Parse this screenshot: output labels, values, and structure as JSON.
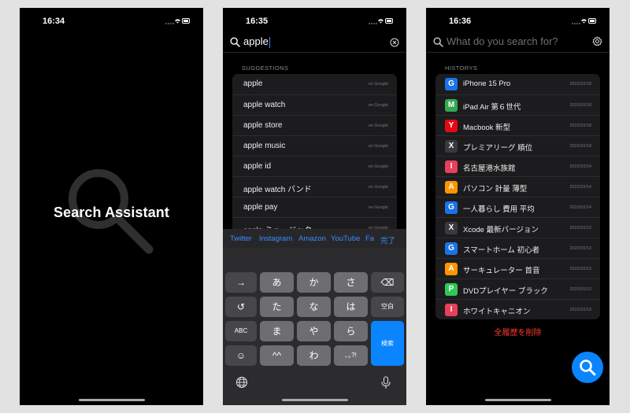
{
  "screen1": {
    "status": {
      "time": "16:34"
    },
    "title": "Search Assistant"
  },
  "screen2": {
    "status": {
      "time": "16:35"
    },
    "search_value": "apple",
    "section_label": "SUGGESTIONS",
    "suggestions": [
      {
        "label": "apple",
        "source": "on Google"
      },
      {
        "label": "apple watch",
        "source": "on Google"
      },
      {
        "label": "apple store",
        "source": "on Google"
      },
      {
        "label": "apple music",
        "source": "on Google"
      },
      {
        "label": "apple id",
        "source": "on Google"
      },
      {
        "label": "apple watch バンド",
        "source": "on Google"
      },
      {
        "label": "apple pay",
        "source": "on Google"
      },
      {
        "label": "apple ミュージック",
        "source": "on Google"
      }
    ],
    "keyboard_suggestions": [
      "Twitter",
      "Instagram",
      "Amazon",
      "YouTube",
      "Fa"
    ],
    "done_label": "完了",
    "keys": {
      "r1": [
        "→",
        "あ",
        "か",
        "さ",
        "⌫"
      ],
      "r2": [
        "↺",
        "た",
        "な",
        "は",
        "空白"
      ],
      "r3": [
        "ABC",
        "ま",
        "や",
        "ら"
      ],
      "r4": [
        "☺",
        "^^",
        "わ",
        "､｡?!"
      ],
      "enter": "検索"
    }
  },
  "screen3": {
    "status": {
      "time": "16:36"
    },
    "search_placeholder": "What do you search for?",
    "section_label": "HISTORYS",
    "history": [
      {
        "letter": "G",
        "color": "#1a73e8",
        "label": "iPhone 15 Pro",
        "date": "2023/10/18"
      },
      {
        "letter": "M",
        "color": "#34a853",
        "label": "iPad Air 第６世代",
        "date": "2023/10/18"
      },
      {
        "letter": "Y",
        "color": "#e50914",
        "label": "Macbook 新型",
        "date": "2023/10/18"
      },
      {
        "letter": "X",
        "color": "#3a3a3c",
        "label": "プレミアリーグ 順位",
        "date": "2023/10/18"
      },
      {
        "letter": "I",
        "color": "#e83f5b",
        "label": "名古屋港水族館",
        "date": "2023/10/14"
      },
      {
        "letter": "A",
        "color": "#ff9500",
        "label": "パソコン 計量 薄型",
        "date": "2023/10/14"
      },
      {
        "letter": "G",
        "color": "#1a73e8",
        "label": "一人暮らし 費用 平均",
        "date": "2023/10/14"
      },
      {
        "letter": "X",
        "color": "#3a3a3c",
        "label": "Xcode 最新バージョン",
        "date": "2023/10/13"
      },
      {
        "letter": "G",
        "color": "#1a73e8",
        "label": "スマートホーム 初心者",
        "date": "2023/10/13"
      },
      {
        "letter": "A",
        "color": "#ff9500",
        "label": "サーキュレーター 首音",
        "date": "2023/10/13"
      },
      {
        "letter": "P",
        "color": "#30c85a",
        "label": "DVDプレイヤー ブラック",
        "date": "2023/10/13"
      },
      {
        "letter": "I",
        "color": "#e83f5b",
        "label": "ホワイトキャニオン",
        "date": "2023/10/13"
      }
    ],
    "delete_all_label": "全履歴を削除"
  }
}
